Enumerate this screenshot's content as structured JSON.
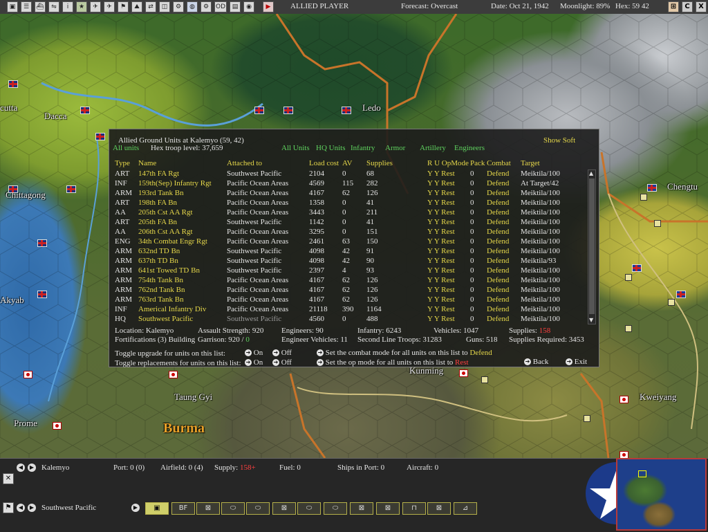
{
  "topbar": {
    "player": "ALLIED PLAYER",
    "forecast": "Forecast: Overcast",
    "date": "Date: Oct 21, 1942",
    "moonlight": "Moonlight: 89%",
    "hex": "Hex: 59 42",
    "button_od": "OD",
    "button_right_c": "C",
    "button_right_x": "X"
  },
  "map": {
    "labels": [
      "cutta",
      "Dacca",
      "Ledo",
      "Chittagong",
      "Akyab",
      "Chengtu",
      "Kunming",
      "Taung Gyi",
      "Kweiyang",
      "Prome",
      "Burma"
    ]
  },
  "dialog": {
    "title": "Allied Ground Units at Kalemyo (59, 42)",
    "show_soft": "Show Soft",
    "all_units_link": "All units",
    "hex_troop_level": "Hex troop level: 37,659",
    "filters": [
      "All Units",
      "HQ Units",
      "Infantry",
      "Armor",
      "Artillery",
      "Engineers"
    ],
    "columns": {
      "type": "Type",
      "name": "Name",
      "attached": "Attached to",
      "load": "Load cost",
      "av": "AV",
      "supplies": "Supplies",
      "ru": "R U OpMode",
      "pack": "Pack",
      "combat": "Combat",
      "target": "Target"
    },
    "rows": [
      {
        "type": "ART",
        "name": "147th FA Rgt",
        "attached": "Southwest Pacific",
        "load": "2104",
        "av": "0",
        "supplies": "68",
        "ru": "Y Y Rest",
        "pack": "0",
        "combat": "Defend",
        "target": "Meiktila/100"
      },
      {
        "type": "INF",
        "name": "159th(Sep) Infantry Rgt",
        "attached": "Pacific Ocean Areas",
        "load": "4569",
        "av": "115",
        "supplies": "282",
        "ru": "Y Y Rest",
        "pack": "0",
        "combat": "Defend",
        "target": "At Target/42"
      },
      {
        "type": "ARM",
        "name": "193rd Tank Bn",
        "attached": "Pacific Ocean Areas",
        "load": "4167",
        "av": "62",
        "supplies": "126",
        "ru": "Y Y Rest",
        "pack": "0",
        "combat": "Defend",
        "target": "Meiktila/100"
      },
      {
        "type": "ART",
        "name": "198th FA Bn",
        "attached": "Pacific Ocean Areas",
        "load": "1358",
        "av": "0",
        "supplies": "41",
        "ru": "Y Y Rest",
        "pack": "0",
        "combat": "Defend",
        "target": "Meiktila/100"
      },
      {
        "type": "AA",
        "name": "205th Cst AA Rgt",
        "attached": "Pacific Ocean Areas",
        "load": "3443",
        "av": "0",
        "supplies": "211",
        "ru": "Y Y Rest",
        "pack": "0",
        "combat": "Defend",
        "target": "Meiktila/100"
      },
      {
        "type": "ART",
        "name": "205th FA Bn",
        "attached": "Southwest Pacific",
        "load": "1142",
        "av": "0",
        "supplies": "41",
        "ru": "Y Y Rest",
        "pack": "0",
        "combat": "Defend",
        "target": "Meiktila/100"
      },
      {
        "type": "AA",
        "name": "206th Cst AA Rgt",
        "attached": "Pacific Ocean Areas",
        "load": "3295",
        "av": "0",
        "supplies": "151",
        "ru": "Y Y Rest",
        "pack": "0",
        "combat": "Defend",
        "target": "Meiktila/100"
      },
      {
        "type": "ENG",
        "name": "34th Combat Engr Rgt",
        "attached": "Pacific Ocean Areas",
        "load": "2461",
        "av": "63",
        "supplies": "150",
        "ru": "Y Y Rest",
        "pack": "0",
        "combat": "Defend",
        "target": "Meiktila/100"
      },
      {
        "type": "ARM",
        "name": "632nd TD Bn",
        "attached": "Southwest Pacific",
        "load": "4098",
        "av": "42",
        "supplies": "91",
        "ru": "Y Y Rest",
        "pack": "0",
        "combat": "Defend",
        "target": "Meiktila/100"
      },
      {
        "type": "ARM",
        "name": "637th TD Bn",
        "attached": "Southwest Pacific",
        "load": "4098",
        "av": "42",
        "supplies": "90",
        "ru": "Y Y Rest",
        "pack": "0",
        "combat": "Defend",
        "target": "Meiktila/93"
      },
      {
        "type": "ARM",
        "name": "641st Towed TD Bn",
        "attached": "Southwest Pacific",
        "load": "2397",
        "av": "4",
        "supplies": "93",
        "ru": "Y Y Rest",
        "pack": "0",
        "combat": "Defend",
        "target": "Meiktila/100"
      },
      {
        "type": "ARM",
        "name": "754th Tank Bn",
        "attached": "Pacific Ocean Areas",
        "load": "4167",
        "av": "62",
        "supplies": "126",
        "ru": "Y Y Rest",
        "pack": "0",
        "combat": "Defend",
        "target": "Meiktila/100"
      },
      {
        "type": "ARM",
        "name": "762nd Tank Bn",
        "attached": "Pacific Ocean Areas",
        "load": "4167",
        "av": "62",
        "supplies": "126",
        "ru": "Y Y Rest",
        "pack": "0",
        "combat": "Defend",
        "target": "Meiktila/100"
      },
      {
        "type": "ARM",
        "name": "763rd Tank Bn",
        "attached": "Pacific Ocean Areas",
        "load": "4167",
        "av": "62",
        "supplies": "126",
        "ru": "Y Y Rest",
        "pack": "0",
        "combat": "Defend",
        "target": "Meiktila/100"
      },
      {
        "type": "INF",
        "name": "Americal Infantry Div",
        "attached": "Pacific Ocean Areas",
        "load": "21118",
        "av": "390",
        "supplies": "1164",
        "ru": "Y Y Rest",
        "pack": "0",
        "combat": "Defend",
        "target": "Meiktila/100"
      },
      {
        "type": "HQ",
        "name": "Southwest Pacific",
        "attached": "Southwest Pacific",
        "load": "4560",
        "av": "0",
        "supplies": "488",
        "ru": "Y Y Rest",
        "pack": "0",
        "combat": "Defend",
        "target": "Meiktila/100"
      }
    ],
    "summary": {
      "location": "Location: Kalemyo",
      "assault": "Assault Strength: 920",
      "engineers": "Engineers: 90",
      "infantry": "Infantry: 6243",
      "vehicles": "Vehicles: 1047",
      "supplies_label": "Supplies:",
      "supplies_value": "158",
      "fortifications": "Fortifications (3) Building",
      "garrison_label": "Garrison: 920 /",
      "garrison_value": "0",
      "eng_vehicles": "Engineer Vehicles: 11",
      "second_line": "Second Line Troops: 31283",
      "guns": "Guns: 518",
      "supplies_required": "Supplies Required: 3453"
    },
    "controls": {
      "toggle_upgrade": "Toggle upgrade for units on this list:",
      "toggle_replacements": "Toggle replacements for units on this list:",
      "on": "On",
      "off": "Off",
      "set_combat": "Set the combat mode for all units on this list to",
      "combat_mode": "Defend",
      "set_op": "Set the op mode for all units on this list to",
      "op_mode": "Rest",
      "back": "Back",
      "exit": "Exit"
    }
  },
  "bottom": {
    "location": "Kalemyo",
    "port": "Port: 0 (0)",
    "airfield": "Airfield: 0 (4)",
    "supply_label": "Supply:",
    "supply_value": "158+",
    "fuel": "Fuel: 0",
    "ships": "Ships in Port: 0",
    "aircraft": "Aircraft: 0",
    "command": "Southwest Pacific",
    "strip_bf": "BF"
  },
  "colors": {
    "label_yellow": "#e6d84a",
    "label_green": "#5fd35f",
    "alert_red": "#ff4040",
    "panel_bg": "#1c1c1c"
  }
}
